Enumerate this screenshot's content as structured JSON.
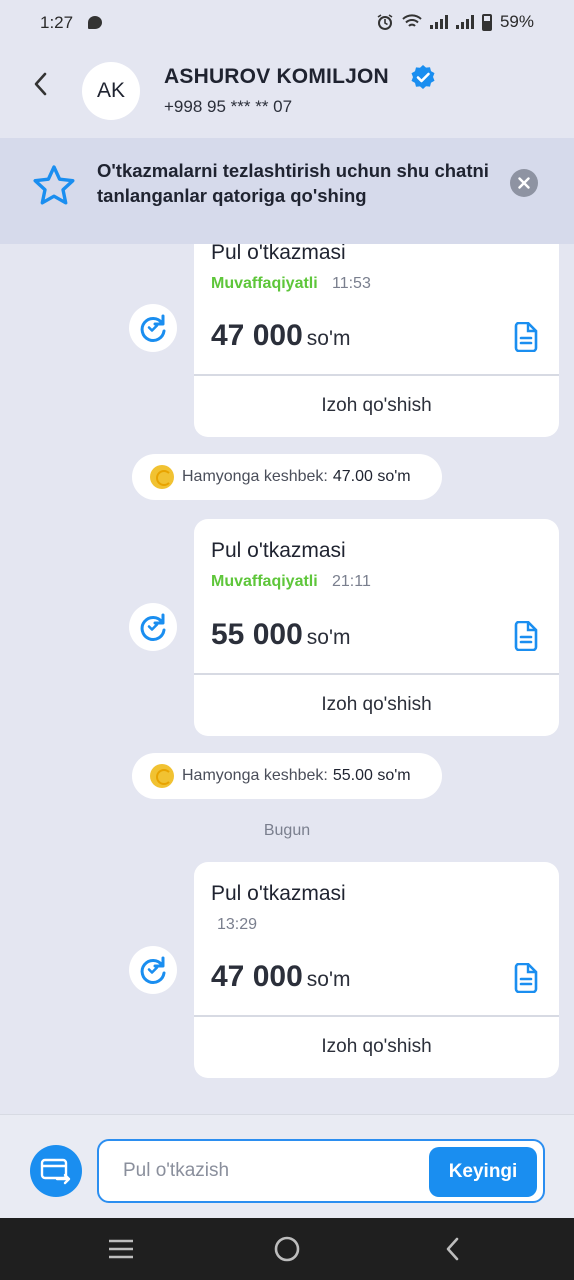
{
  "status_bar": {
    "time": "1:27",
    "battery": "59%"
  },
  "header": {
    "avatar_initials": "AK",
    "name": "ASHUROV KOMILJON",
    "phone": "+998 95 *** ** 07"
  },
  "banner": {
    "text": "O'tkazmalarni tezlashtirish uchun shu chatni tanlanganlar qatoriga qo'shing"
  },
  "messages": [
    {
      "title": "Pul o'tkazmasi",
      "status": "Muvaffaqiyatli",
      "time": "11:53",
      "amount": "47 000",
      "currency": "so'm",
      "comment_label": "Izoh qo'shish"
    },
    {
      "title": "Pul o'tkazmasi",
      "status": "Muvaffaqiyatli",
      "time": "21:11",
      "amount": "55 000",
      "currency": "so'm",
      "comment_label": "Izoh qo'shish"
    },
    {
      "title": "Pul o'tkazmasi",
      "status": "",
      "time": "13:29",
      "amount": "47 000",
      "currency": "so'm",
      "comment_label": "Izoh qo'shish"
    }
  ],
  "cashbacks": [
    {
      "label": "Hamyonga keshbek:",
      "amount": "47.00 so'm"
    },
    {
      "label": "Hamyonga keshbek:",
      "amount": "55.00 so'm"
    }
  ],
  "date_separator": "Bugun",
  "composer": {
    "placeholder": "Pul o'tkazish",
    "next_label": "Keyingi"
  },
  "icons": {
    "back": "chevron-left-icon",
    "verified": "verified-badge-icon",
    "star": "star-outline-icon",
    "close": "close-icon",
    "repeat": "repeat-icon",
    "document": "document-icon",
    "coin": "coin-icon",
    "wallet": "wallet-transfer-icon"
  },
  "colors": {
    "accent": "#1a8ef0",
    "success": "#5ec63a",
    "background": "#e4e6f1"
  }
}
